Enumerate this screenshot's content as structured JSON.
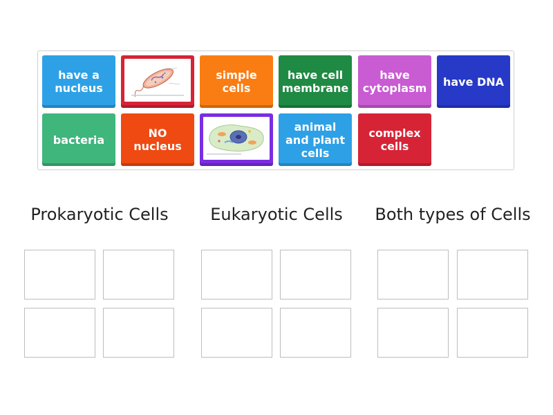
{
  "tiles": [
    {
      "label": "have a\nnucleus",
      "color": "#2ea1e6"
    },
    {
      "label": "",
      "image": "bacterium-diagram",
      "color": "#d62436"
    },
    {
      "label": "simple\ncells",
      "color": "#fa7d13"
    },
    {
      "label": "have cell\nmembrane",
      "color": "#1f8a43"
    },
    {
      "label": "have\ncytoplasm",
      "color": "#c95bd3"
    },
    {
      "label": "have DNA",
      "color": "#2639c7"
    },
    {
      "label": "bacteria",
      "color": "#3fb67c"
    },
    {
      "label": "NO\nnucleus",
      "color": "#ef4a12"
    },
    {
      "label": "",
      "image": "animal-cell-diagram",
      "color": "#7a2ee0"
    },
    {
      "label": "animal\nand plant\ncells",
      "color": "#2ea1e6"
    },
    {
      "label": "complex\ncells",
      "color": "#d62436"
    }
  ],
  "groups": [
    {
      "title": "Prokaryotic Cells"
    },
    {
      "title": "Eukaryotic Cells"
    },
    {
      "title": "Both types of Cells"
    }
  ]
}
